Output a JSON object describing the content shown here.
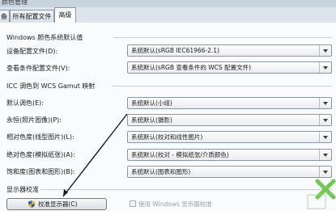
{
  "window": {
    "title": "颜色管理"
  },
  "tabs": [
    {
      "label": "备"
    },
    {
      "label": "所有配置文件"
    },
    {
      "label": "高级"
    }
  ],
  "windows_defaults": {
    "title": "Windows 颜色系统默认值",
    "rows": [
      {
        "label": "设备配置文件(D):",
        "value": "系统默认(sRGB IEC61966-2.1)"
      },
      {
        "label": "查看条件配置文件(V):",
        "value": "系统默认(sRGB 查看条件的 WCS 配置文件)"
      }
    ]
  },
  "icc_mapping": {
    "title": "ICC 调色到 WCS Gamut 映射",
    "rows": [
      {
        "label": "默认调色(E):",
        "value": "系统默认(小组)"
      },
      {
        "label": "永恒(照片图像)(P):",
        "value": "系统默认(摄影)"
      },
      {
        "label": "相对色度(线型图片)(L):",
        "value": "系统默认(校对和线性图片)"
      },
      {
        "label": "绝对色度(模拟纸张)(A):",
        "value": "系统默认(校对 - 模拟纸张/介质颜色)"
      },
      {
        "label": "饱和度(图表和图形)(B):",
        "value": "系统默认(图表和图形)"
      }
    ]
  },
  "calibration": {
    "title": "显示器校准",
    "button_label": "校准显示器(C)",
    "checkbox_label": "使用 Windows 显示器校准"
  }
}
